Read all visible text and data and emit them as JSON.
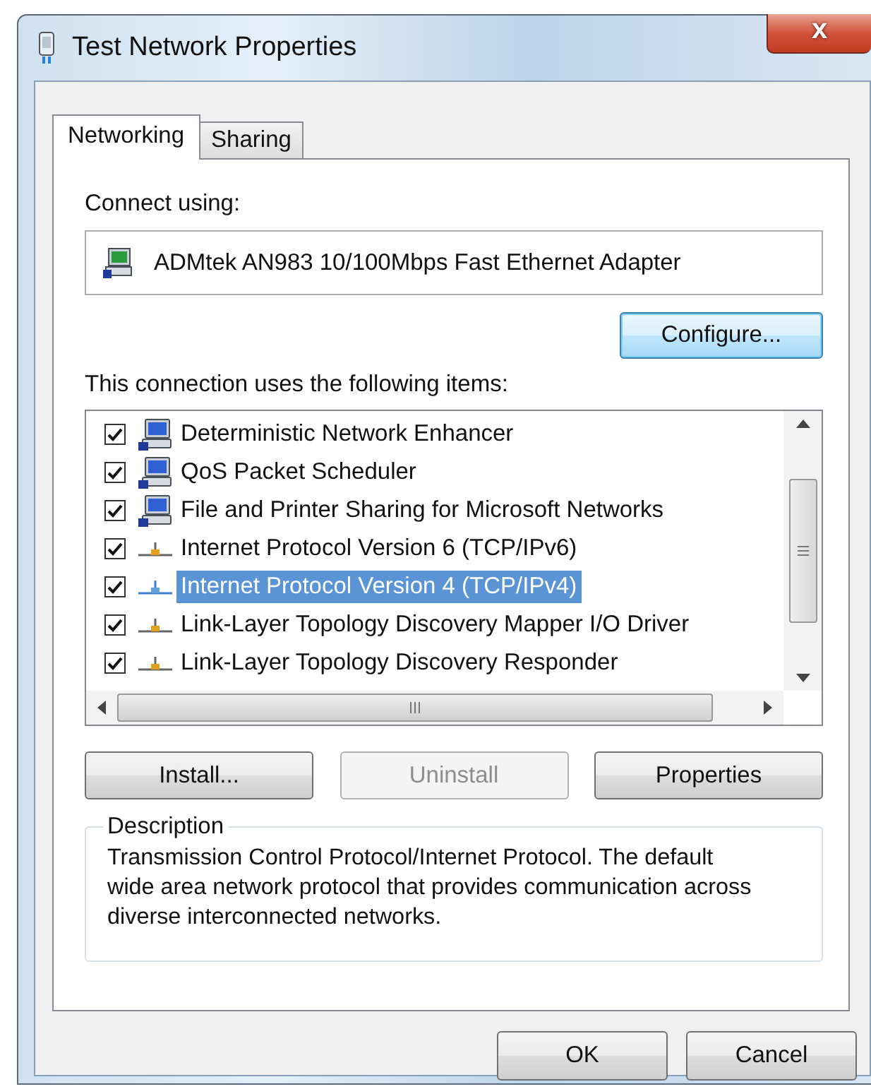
{
  "window": {
    "title": "Test Network Properties",
    "close": "x"
  },
  "tabs": [
    {
      "label": "Networking",
      "selected": true
    },
    {
      "label": "Sharing",
      "selected": false
    }
  ],
  "connect_using": {
    "label": "Connect using:",
    "adapter": "ADMtek AN983 10/100Mbps Fast Ethernet Adapter",
    "button": "Configure..."
  },
  "items_label": "This connection uses the following items:",
  "items": [
    {
      "kind": "service",
      "label": "Deterministic Network Enhancer",
      "checked": true,
      "selected": false
    },
    {
      "kind": "service",
      "label": "QoS Packet Scheduler",
      "checked": true,
      "selected": false
    },
    {
      "kind": "service",
      "label": "File and Printer Sharing for Microsoft Networks",
      "checked": true,
      "selected": false
    },
    {
      "kind": "protocol",
      "label": "Internet Protocol Version 6 (TCP/IPv6)",
      "checked": true,
      "selected": false
    },
    {
      "kind": "protocol",
      "label": "Internet Protocol Version 4 (TCP/IPv4)",
      "checked": true,
      "selected": true
    },
    {
      "kind": "protocol",
      "label": "Link-Layer Topology Discovery Mapper I/O Driver",
      "checked": true,
      "selected": false
    },
    {
      "kind": "protocol",
      "label": "Link-Layer Topology Discovery Responder",
      "checked": true,
      "selected": false
    }
  ],
  "item_buttons": [
    {
      "label": "Install...",
      "disabled": false
    },
    {
      "label": "Uninstall",
      "disabled": true
    },
    {
      "label": "Properties",
      "disabled": false
    }
  ],
  "description": {
    "title": "Description",
    "text": "Transmission Control Protocol/Internet Protocol. The default wide area network protocol that provides communication across diverse interconnected networks."
  },
  "dialog_buttons": [
    {
      "label": "OK",
      "disabled": false
    },
    {
      "label": "Cancel",
      "disabled": false
    }
  ]
}
